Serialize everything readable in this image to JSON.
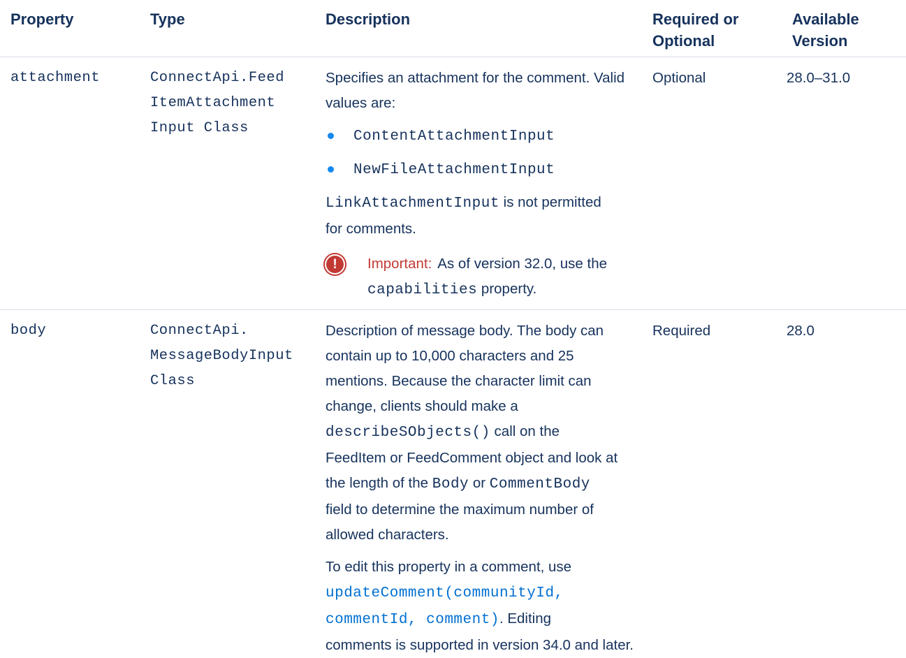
{
  "header": {
    "property": "Property",
    "type": "Type",
    "description": "Description",
    "required_line1": "Required or",
    "required_line2": "Optional",
    "available_line1": "Available",
    "available_line2": "Version"
  },
  "rows": [
    {
      "property": "attachment",
      "type_line1": "ConnectApi.Feed",
      "type_line2": "ItemAttachment",
      "type_line3": "Input Class",
      "desc_line1": "Specifies an attachment for the comment. Valid",
      "desc_line2": "values are:",
      "bullet1": "ContentAttachmentInput",
      "bullet2": "NewFileAttachmentInput",
      "note_code": "LinkAttachmentInput",
      "note_text1": " is not permitted",
      "note_text2": "for comments.",
      "important_label": "Important:",
      "important_text1": "As of version 32.0, use the",
      "important_code": "capabilities",
      "important_text2": " property.",
      "required": "Optional",
      "version": "28.0–31.0"
    },
    {
      "property": "body",
      "type_line1": "ConnectApi.",
      "type_line2": "MessageBodyInput",
      "type_line3": "Class",
      "desc_l1": "Description of message body. The body can",
      "desc_l2": "contain up to 10,000 characters and 25",
      "desc_l3": "mentions. Because the character limit can",
      "desc_l4": "change, clients should make a",
      "desc_code1": "describeSObjects()",
      "desc_l5b": " call on the",
      "desc_l6": "FeedItem or FeedComment object and look at",
      "desc_l7a": "the length of the ",
      "desc_code2": "Body",
      "desc_l7b": " or ",
      "desc_code3": "CommentBody",
      "desc_l8": "field to determine the maximum number of",
      "desc_l9": "allowed characters.",
      "edit_l1": "To edit this property in a comment, use",
      "edit_link1": "updateComment(communityId,",
      "edit_link2": "commentId, comment)",
      "edit_l3b": ". Editing",
      "edit_l4": "comments is supported in version 34.0 and later.",
      "required": "Required",
      "version": "28.0"
    }
  ]
}
